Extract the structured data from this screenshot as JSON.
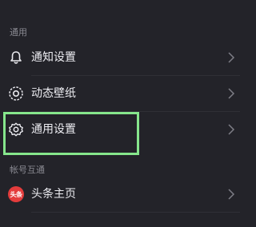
{
  "sections": {
    "general": "通用",
    "account": "帐号互通"
  },
  "rows": [
    {
      "label": "通知设置",
      "icon": "bell-icon"
    },
    {
      "label": "动态壁纸",
      "icon": "dynamic-wallpaper-icon"
    },
    {
      "label": "通用设置",
      "icon": "gear-icon"
    },
    {
      "label": "头条主页",
      "icon": "toutiao-logo-icon"
    }
  ],
  "avatar_text": "头条",
  "colors": {
    "background": "#232329",
    "highlight": "#86e68c",
    "brand_red": "#e43c3c"
  }
}
